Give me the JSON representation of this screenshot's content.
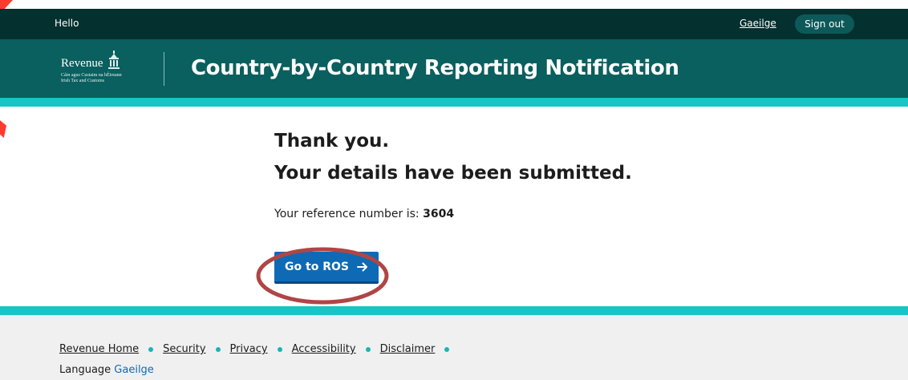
{
  "top_bar": {
    "greeting": "Hello",
    "language_link": "Gaeilge",
    "sign_out": "Sign out"
  },
  "header": {
    "logo_word": "Revenue",
    "logo_subtitle_line1": "Cáin agus Custaim na hÉireann",
    "logo_subtitle_line2": "Irish Tax and Customs",
    "title": "Country-by-Country Reporting Notification"
  },
  "main": {
    "heading_line1": "Thank you.",
    "heading_line2": "Your details have been submitted.",
    "reference_label": "Your reference number is:",
    "reference_number": "3604",
    "go_button_label": "Go to ROS",
    "go_button_icon": "arrow-right-icon"
  },
  "footer": {
    "links": [
      "Revenue Home",
      "Security",
      "Privacy",
      "Accessibility",
      "Disclaimer"
    ],
    "language_label": "Language",
    "language_link": "Gaeilge"
  },
  "colors": {
    "top_bar": "#053030",
    "header": "#0a5f5f",
    "accent": "#18c4c4",
    "button": "#0e6ab5",
    "annotation": "#b04545"
  }
}
